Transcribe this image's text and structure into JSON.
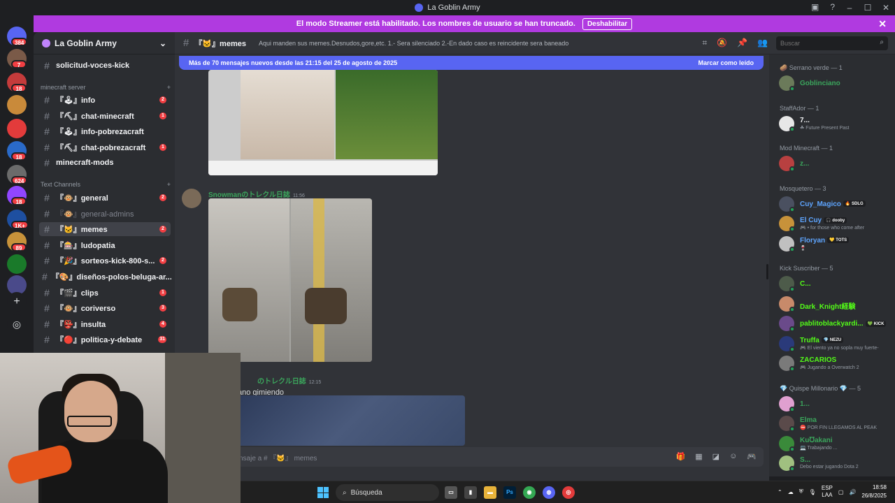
{
  "window": {
    "title": "La Goblin Army"
  },
  "banner": {
    "text": "El modo Streamer está habilitado. Los nombres de usuario se han truncado.",
    "button": "Deshabilitar",
    "close": "✕"
  },
  "rail": {
    "servers": [
      {
        "badge": "384",
        "color": "#5865f2"
      },
      {
        "badge": "7",
        "color": "#7a5a48"
      },
      {
        "badge": "18",
        "color": "#c43b3b"
      },
      {
        "badge": "",
        "color": "#c98a3a"
      },
      {
        "badge": "",
        "color": "#e33b3b"
      },
      {
        "badge": "18",
        "color": "#2a6ac8"
      },
      {
        "badge": "624",
        "color": "#6b6b6b"
      },
      {
        "badge": "18",
        "color": "#9146ff"
      },
      {
        "badge": "1K+",
        "color": "#1e4fa0"
      },
      {
        "badge": "89",
        "color": "#c7923a"
      },
      {
        "badge": "",
        "color": "#1a7a2a"
      },
      {
        "badge": "",
        "color": "#4a4a8a"
      }
    ]
  },
  "sidebar": {
    "server_name": "La Goblin Army",
    "top_channel": "solicitud-voces-kick",
    "cat_minecraft": "minecraft server",
    "minecraft": [
      {
        "name": "『🕹』info",
        "count": "2"
      },
      {
        "name": "『⛏』chat-minecraft",
        "count": "1"
      },
      {
        "name": "『🕹』info-pobrezacraft",
        "count": ""
      },
      {
        "name": "『⛏』chat-pobrezacraft",
        "count": "1"
      },
      {
        "name": "minecraft-mods",
        "count": ""
      }
    ],
    "cat_text": "Text Channels",
    "text": [
      {
        "name": "『🐵』general",
        "count": "2"
      },
      {
        "name": "『🐵』general-admins",
        "count": ""
      },
      {
        "name": "『🐱』memes",
        "count": "2"
      },
      {
        "name": "『🎰』ludopatia",
        "count": ""
      },
      {
        "name": "『🎉』sorteos-kick-800-s...",
        "count": "2"
      },
      {
        "name": "『🎨』diseños-polos-beluga-ar...",
        "count": ""
      },
      {
        "name": "『🎬』clips",
        "count": "1"
      },
      {
        "name": "『🐵』coriverso",
        "count": "3"
      },
      {
        "name": "『👺』insulta",
        "count": "4"
      },
      {
        "name": "『🔴』politica-y-debate",
        "count": "31"
      }
    ]
  },
  "header": {
    "channel": "『🐱』memes",
    "topic": "Aqui manden sus memes.Desnudos,gore,etc. 1.- Sera silenciado 2.-En dado caso es reincidente sera baneado",
    "search_placeholder": "Buscar"
  },
  "chat": {
    "new_messages": "Más de 70 mensajes nuevos desde las 21:15 del 25 de agosto de 2025",
    "mark_read": "Marcar como leído",
    "msg1_user": "Snowmanのトレクル日誌",
    "msg1_time": "11:56",
    "msg2_user": "のトレクル日誌",
    "msg2_time": "12:15",
    "msg2_text": "ano gimiendo",
    "composer_placeholder": "nsaje a # 『🐱』 memes"
  },
  "members": {
    "groups": [
      {
        "title": "🥔 Serrano verde — 1",
        "members": [
          {
            "name": "Goblinciano",
            "status": "",
            "color": "#3ba55c",
            "tag": ""
          }
        ]
      },
      {
        "title": "StaffAdor — 1",
        "members": [
          {
            "name": "7...",
            "status": "☘ Future Present Past",
            "color": "#f2f3f5",
            "tag": ""
          }
        ]
      },
      {
        "title": "Mod Minecraft — 1",
        "members": [
          {
            "name": "z...",
            "status": "",
            "color": "#3ba55c",
            "tag": ""
          }
        ]
      },
      {
        "title": "Mosquetero — 3",
        "members": [
          {
            "name": "Cuy_Magico",
            "status": "",
            "color": "#5ea5ff",
            "tag": "🔥 SDLG"
          },
          {
            "name": "El Cuy",
            "status": "🎮 • for those who come after",
            "color": "#5ea5ff",
            "tag": "🎧 dooby"
          },
          {
            "name": "Floryan",
            "status": "🍷",
            "color": "#5ea5ff",
            "tag": "💛 TOTS"
          }
        ]
      },
      {
        "title": "Kick Suscriber — 5",
        "members": [
          {
            "name": "C...",
            "status": "",
            "color": "#53fc18",
            "tag": ""
          },
          {
            "name": "Dark_Knight経験",
            "status": "",
            "color": "#53fc18",
            "tag": ""
          },
          {
            "name": "pablitoblackyardi...",
            "status": "",
            "color": "#53fc18",
            "tag": "💚 KICK"
          },
          {
            "name": "Truffa",
            "status": "🎮 El viento ya no sopla muy fuerte-",
            "color": "#53fc18",
            "tag": "💎 NEZU"
          },
          {
            "name": "ZACARIOS",
            "status": "🎮 Jugando a Overwatch 2",
            "color": "#53fc18",
            "tag": ""
          }
        ]
      },
      {
        "title": "💎 Quispe Millonario 💎 — 5",
        "members": [
          {
            "name": "1...",
            "status": "",
            "color": "#3ba55c",
            "tag": ""
          },
          {
            "name": "Elma",
            "status": "⛔ POR FIN LLEGAMOS AL PEAK",
            "color": "#3ba55c",
            "tag": ""
          },
          {
            "name": "Ku℧akani",
            "status": "💻 Trabajando ...",
            "color": "#3ba55c",
            "tag": ""
          },
          {
            "name": "S...",
            "status": "Debo estar jugando Dota 2",
            "color": "#3ba55c",
            "tag": ""
          }
        ]
      }
    ]
  },
  "taskbar": {
    "search": "Búsqueda",
    "lang1": "ESP",
    "lang2": "LAA",
    "time": "18:58",
    "date": "26/8/2025"
  }
}
